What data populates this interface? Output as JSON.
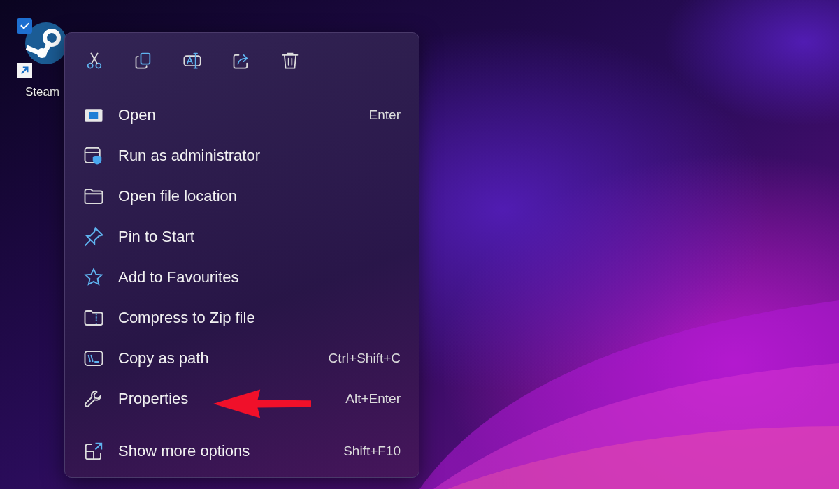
{
  "desktop_icon": {
    "label": "Steam",
    "selected": true
  },
  "context_menu": {
    "toolbar": [
      {
        "kind": "cut"
      },
      {
        "kind": "copy"
      },
      {
        "kind": "rename"
      },
      {
        "kind": "share"
      },
      {
        "kind": "delete"
      }
    ],
    "sections": [
      [
        {
          "label": "Open",
          "shortcut": "Enter"
        },
        {
          "label": "Run as administrator"
        },
        {
          "label": "Open file location"
        },
        {
          "label": "Pin to Start"
        },
        {
          "label": "Add to Favourites"
        },
        {
          "label": "Compress to Zip file"
        },
        {
          "label": "Copy as path",
          "shortcut": "Ctrl+Shift+C"
        },
        {
          "label": "Properties",
          "shortcut": "Alt+Enter"
        }
      ],
      [
        {
          "label": "Show more options",
          "shortcut": "Shift+F10"
        }
      ]
    ]
  }
}
